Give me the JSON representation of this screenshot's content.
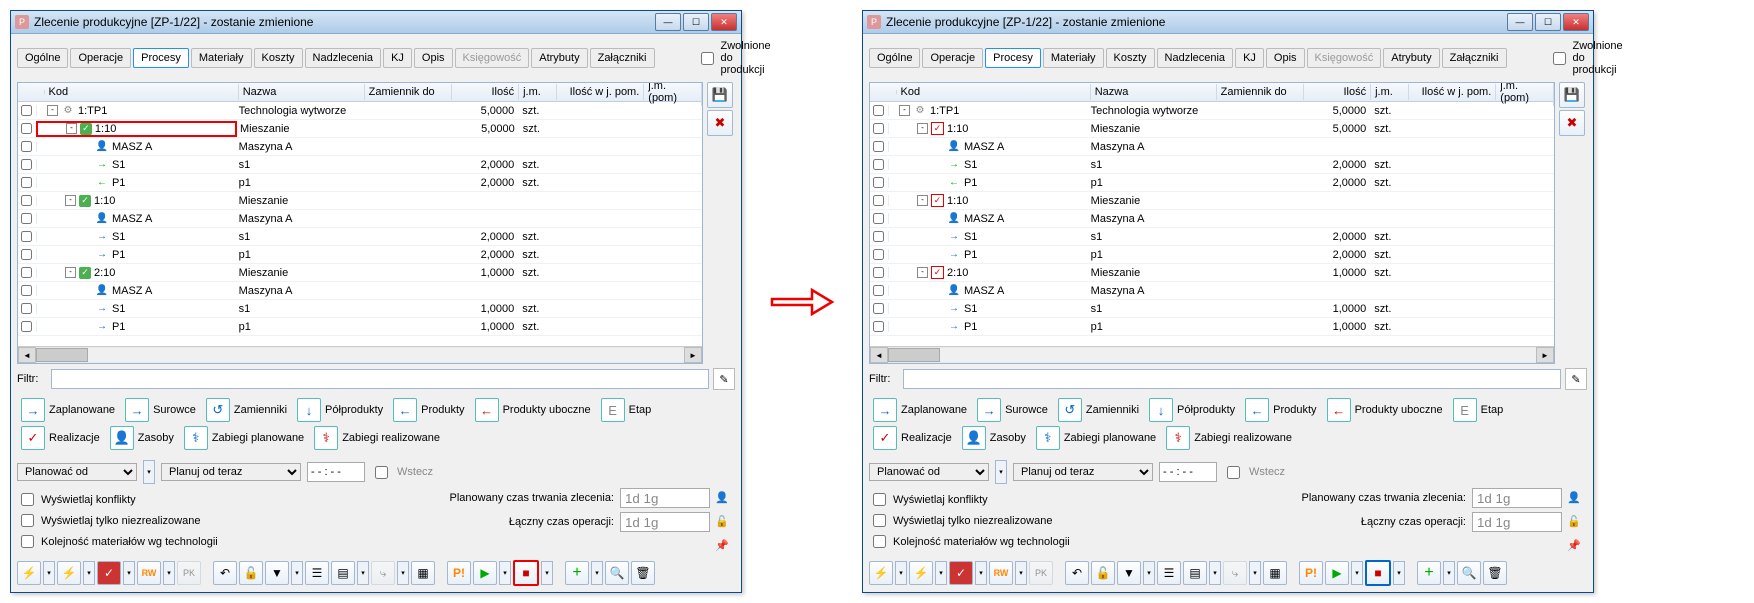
{
  "window": {
    "title": "Zlecenie produkcyjne  [ZP-1/22] - zostanie zmienione",
    "icon_letter": "P"
  },
  "tabs": [
    "Ogólne",
    "Operacje",
    "Procesy",
    "Materiały",
    "Koszty",
    "Nadzlecenia",
    "KJ",
    "Opis",
    "Księgowość",
    "Atrybuty",
    "Załączniki"
  ],
  "active_tab": "Procesy",
  "disabled_tab": "Księgowość",
  "release_label": "Zwolnione do produkcji",
  "columns": {
    "kod": "Kod",
    "nazwa": "Nazwa",
    "zam": "Zamiennik do",
    "ilosc": "Ilość",
    "jm": "j.m.",
    "ilosc2": "Ilość w j. pom.",
    "jm2": "j.m. (pom)"
  },
  "rows": [
    {
      "indent": 0,
      "exp": "-",
      "icon": "gear",
      "kod": "1:TP1",
      "nazwa": "Technologia wytworze",
      "ilosc": "5,0000",
      "jm": "szt.",
      "hl": false
    },
    {
      "indent": 1,
      "exp": "-",
      "icon": "check-green",
      "kod": "1:10",
      "nazwa": "Mieszanie",
      "ilosc": "5,0000",
      "jm": "szt.",
      "hl": true
    },
    {
      "indent": 2,
      "exp": "",
      "icon": "person",
      "kod": "MASZ A",
      "nazwa": "Maszyna A",
      "ilosc": "",
      "jm": ""
    },
    {
      "indent": 2,
      "exp": "",
      "icon": "arrow-r",
      "kod": "S1",
      "nazwa": "s1",
      "ilosc": "2,0000",
      "jm": "szt."
    },
    {
      "indent": 2,
      "exp": "",
      "icon": "arrow-l",
      "kod": "P1",
      "nazwa": "p1",
      "ilosc": "2,0000",
      "jm": "szt."
    },
    {
      "indent": 1,
      "exp": "-",
      "icon": "check-green",
      "kod": "1:10",
      "nazwa": "Mieszanie",
      "ilosc": "",
      "jm": ""
    },
    {
      "indent": 2,
      "exp": "",
      "icon": "person",
      "kod": "MASZ A",
      "nazwa": "Maszyna A",
      "ilosc": "",
      "jm": ""
    },
    {
      "indent": 2,
      "exp": "",
      "icon": "arrow-rb",
      "kod": "S1",
      "nazwa": "s1",
      "ilosc": "2,0000",
      "jm": "szt."
    },
    {
      "indent": 2,
      "exp": "",
      "icon": "arrow-rb",
      "kod": "P1",
      "nazwa": "p1",
      "ilosc": "2,0000",
      "jm": "szt."
    },
    {
      "indent": 1,
      "exp": "-",
      "icon": "check-green",
      "kod": "2:10",
      "nazwa": "Mieszanie",
      "ilosc": "1,0000",
      "jm": "szt."
    },
    {
      "indent": 2,
      "exp": "",
      "icon": "person",
      "kod": "MASZ A",
      "nazwa": "Maszyna A",
      "ilosc": "",
      "jm": ""
    },
    {
      "indent": 2,
      "exp": "",
      "icon": "arrow-rb",
      "kod": "S1",
      "nazwa": "s1",
      "ilosc": "1,0000",
      "jm": "szt."
    },
    {
      "indent": 2,
      "exp": "",
      "icon": "arrow-rb",
      "kod": "P1",
      "nazwa": "p1",
      "ilosc": "1,0000",
      "jm": "szt."
    }
  ],
  "rows_right": [
    {
      "indent": 0,
      "exp": "-",
      "icon": "gear",
      "kod": "1:TP1",
      "nazwa": "Technologia wytworze",
      "ilosc": "5,0000",
      "jm": "szt."
    },
    {
      "indent": 1,
      "exp": "-",
      "icon": "check-red",
      "kod": "1:10",
      "nazwa": "Mieszanie",
      "ilosc": "5,0000",
      "jm": "szt."
    },
    {
      "indent": 2,
      "exp": "",
      "icon": "person",
      "kod": "MASZ A",
      "nazwa": "Maszyna A",
      "ilosc": "",
      "jm": ""
    },
    {
      "indent": 2,
      "exp": "",
      "icon": "arrow-r",
      "kod": "S1",
      "nazwa": "s1",
      "ilosc": "2,0000",
      "jm": "szt."
    },
    {
      "indent": 2,
      "exp": "",
      "icon": "arrow-l",
      "kod": "P1",
      "nazwa": "p1",
      "ilosc": "2,0000",
      "jm": "szt."
    },
    {
      "indent": 1,
      "exp": "-",
      "icon": "check-red",
      "kod": "1:10",
      "nazwa": "Mieszanie",
      "ilosc": "",
      "jm": ""
    },
    {
      "indent": 2,
      "exp": "",
      "icon": "person",
      "kod": "MASZ A",
      "nazwa": "Maszyna A",
      "ilosc": "",
      "jm": ""
    },
    {
      "indent": 2,
      "exp": "",
      "icon": "arrow-rb",
      "kod": "S1",
      "nazwa": "s1",
      "ilosc": "2,0000",
      "jm": "szt."
    },
    {
      "indent": 2,
      "exp": "",
      "icon": "arrow-rb",
      "kod": "P1",
      "nazwa": "p1",
      "ilosc": "2,0000",
      "jm": "szt."
    },
    {
      "indent": 1,
      "exp": "-",
      "icon": "check-red",
      "kod": "2:10",
      "nazwa": "Mieszanie",
      "ilosc": "1,0000",
      "jm": "szt."
    },
    {
      "indent": 2,
      "exp": "",
      "icon": "person",
      "kod": "MASZ A",
      "nazwa": "Maszyna A",
      "ilosc": "",
      "jm": ""
    },
    {
      "indent": 2,
      "exp": "",
      "icon": "arrow-rb",
      "kod": "S1",
      "nazwa": "s1",
      "ilosc": "1,0000",
      "jm": "szt."
    },
    {
      "indent": 2,
      "exp": "",
      "icon": "arrow-rb",
      "kod": "P1",
      "nazwa": "p1",
      "ilosc": "1,0000",
      "jm": "szt."
    }
  ],
  "filter_label": "Filtr:",
  "legend": [
    {
      "ico": "→",
      "col": "#06c",
      "label": "Zaplanowane"
    },
    {
      "ico": "→",
      "col": "#06c",
      "label": "Surowce"
    },
    {
      "ico": "↺",
      "col": "#06c",
      "label": "Zamienniki"
    },
    {
      "ico": "↓",
      "col": "#06c",
      "label": "Półprodukty"
    },
    {
      "ico": "←",
      "col": "#06c",
      "label": "Produkty"
    },
    {
      "ico": "←",
      "col": "#c00",
      "label": "Produkty uboczne"
    },
    {
      "ico": "E",
      "col": "#888",
      "label": "Etap"
    },
    {
      "ico": "✓",
      "col": "#c00",
      "label": "Realizacje"
    },
    {
      "ico": "👤",
      "col": "#c80",
      "label": "Zasoby"
    },
    {
      "ico": "⚕",
      "col": "#06c",
      "label": "Zabiegi planowane"
    },
    {
      "ico": "⚕",
      "col": "#c00",
      "label": "Zabiegi realizowane"
    }
  ],
  "plan_label": "Planować od",
  "plan_select": "Planuj od teraz",
  "plan_time": "- - : - -",
  "wstecz": "Wstecz",
  "chk1": "Wyświetlaj konflikty",
  "chk2": "Wyświetlaj tylko niezrealizowane",
  "chk3": "Kolejność materiałów wg technologii",
  "time1_label": "Planowany czas trwania zlecenia:",
  "time2_label": "Łączny czas operacji:",
  "time_val": "1d 1g"
}
